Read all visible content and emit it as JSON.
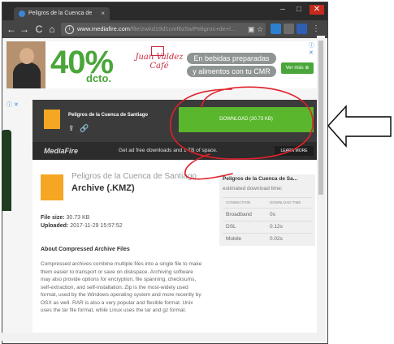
{
  "browser": {
    "tab_title": "Peligros de la Cuenca de",
    "tab_close": "×",
    "url_domain": "www.mediafire.com",
    "url_path": "/file/zwkd19d1cmf6z5a/Peligros+de+l...",
    "nav": {
      "back": "←",
      "forward": "→",
      "reload": "C",
      "home": "⌂"
    },
    "window_controls": {
      "minimize": "–",
      "maximize": "□",
      "close": "✕"
    },
    "info_icon": "i",
    "bookmark_icon": "☆"
  },
  "ad": {
    "percent": "40%",
    "dcto": "dcto.",
    "brand": "Juan Valdez Café",
    "line1": "En bebidas preparadas",
    "line2": "y alimentos con tu CMR",
    "cta": "Ver más ⊕",
    "close": "ⓘ ✕",
    "side_close": "ⓘ ✕"
  },
  "download": {
    "file_name": "Peligros de la Cuenca de Santiago",
    "button": "DOWNLOAD (30.73 KB)",
    "logo": "MediaFire",
    "promo": "Get ad free downloads and 1 TB of space.",
    "learn_more": "LEARN MORE"
  },
  "file": {
    "title": "Peligros de la Cuenca de Santiago",
    "type": "Archive (.KMZ)",
    "size_label": "File size:",
    "size": "30.73 KB",
    "uploaded_label": "Uploaded:",
    "uploaded": "2017-11-29 15:57:52",
    "about_title": "About Compressed Archive Files",
    "about_text": "Compressed archives combine multiple files into a single file to make them easier to transport or save on diskspace. Archiving software may also provide options for encryption, file spanning, checksums, self-extraction, and self-installation. Zip is the most-widely used format, used by the Windows operating system and more recently by OSX as well. RAR is also a very popular and flexible format. Unix uses the tar file format, while Linux uses the tar and gz format."
  },
  "download_time": {
    "heading": "Peligros de la Cuenca de Sa...",
    "subheading": "estimated download time:",
    "col_connection": "CONNECTION",
    "col_time": "DOWNLOAD TIME",
    "rows": [
      {
        "connection": "Broadband",
        "time": "0s"
      },
      {
        "connection": "DSL",
        "time": "0.12s"
      },
      {
        "connection": "Mobile",
        "time": "0.02s"
      }
    ]
  },
  "colors": {
    "accent_green": "#5ab62c",
    "annotation_red": "#e0202a",
    "panel_dark": "#3b3b3b"
  }
}
